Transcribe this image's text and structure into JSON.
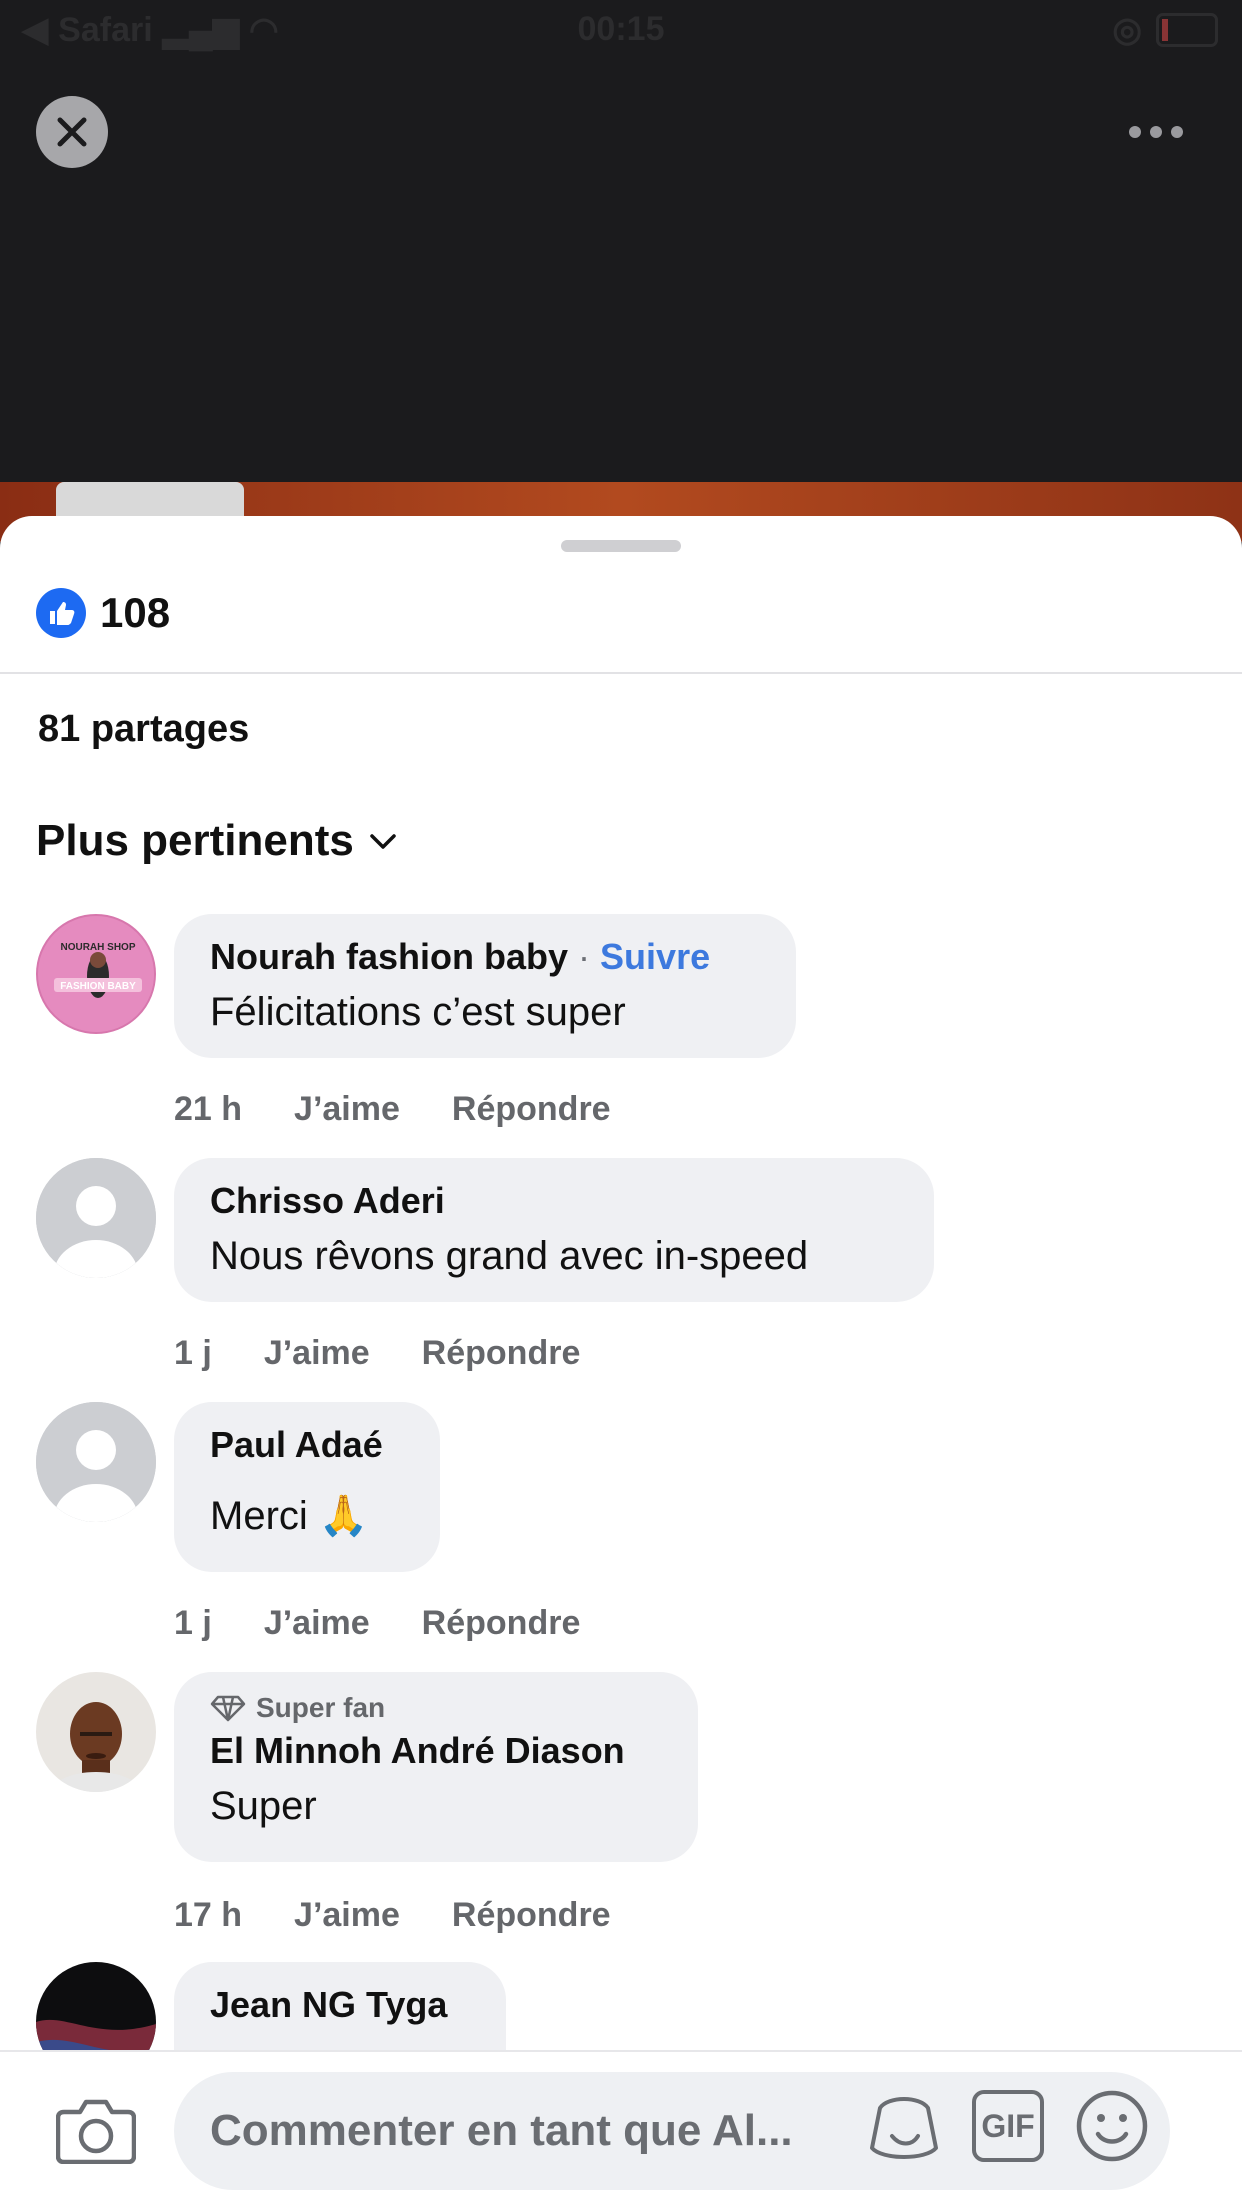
{
  "status": {
    "app": "Safari",
    "time": "00:15"
  },
  "post": {
    "likes": "108",
    "shares": "81 partages"
  },
  "sort": {
    "label": "Plus pertinents"
  },
  "comments": [
    {
      "author": "Nourah fashion baby",
      "follow": "Suivre",
      "text": "Félicitations c’est super",
      "time": "21 h",
      "like": "J’aime",
      "reply": "Répondre",
      "avatar_text_top": "NOURAH SHOP",
      "avatar_text_bottom": "FASHION BABY"
    },
    {
      "author": "Chrisso Aderi",
      "text": "Nous rêvons grand avec in-speed",
      "time": "1 j",
      "like": "J’aime",
      "reply": "Répondre"
    },
    {
      "author": "Paul Adaé",
      "text": "Merci 🙏",
      "time": "1 j",
      "like": "J’aime",
      "reply": "Répondre"
    },
    {
      "badge": "Super fan",
      "author": "El Minnoh André Diason",
      "text": "Super",
      "time": "17 h",
      "like": "J’aime",
      "reply": "Répondre"
    },
    {
      "author": "Jean NG Tyga"
    }
  ],
  "composer": {
    "placeholder": "Commenter en tant que Al...",
    "gif_label": "GIF"
  },
  "colors": {
    "accent": "#1D6AF2",
    "follow": "#3D79DE",
    "bubble": "#EFF0F3"
  }
}
